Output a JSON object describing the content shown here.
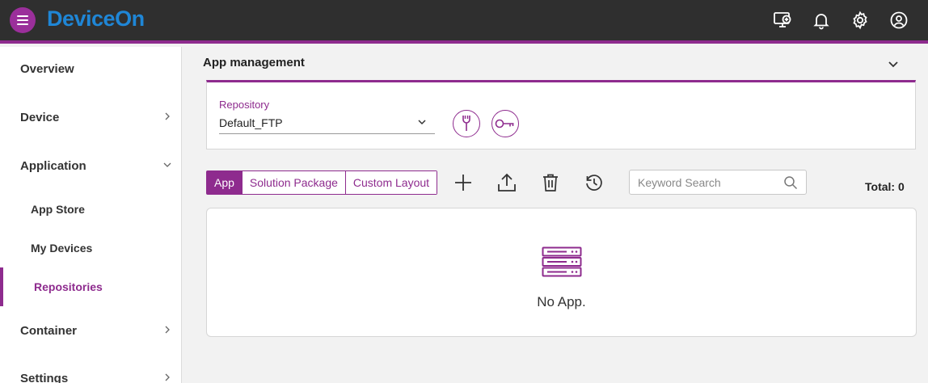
{
  "app": {
    "title": "DeviceOn"
  },
  "topbar": {
    "icons": [
      "monitor-add-icon",
      "bell-icon",
      "gear-icon",
      "user-circle-icon"
    ]
  },
  "sidebar": {
    "items": [
      {
        "label": "Overview"
      },
      {
        "label": "Device"
      },
      {
        "label": "Application"
      },
      {
        "label": "App Store"
      },
      {
        "label": "My Devices"
      },
      {
        "label": "Repositories"
      },
      {
        "label": "Container"
      },
      {
        "label": "Settings"
      }
    ],
    "active": "Repositories"
  },
  "main": {
    "section_title": "App management",
    "repository": {
      "label": "Repository",
      "value": "Default_FTP"
    },
    "tabs": [
      {
        "label": "App",
        "active": true
      },
      {
        "label": "Solution Package",
        "active": false
      },
      {
        "label": "Custom Layout",
        "active": false
      }
    ],
    "toolbar_icons": [
      "add-icon",
      "upload-icon",
      "trash-icon",
      "history-icon"
    ],
    "search": {
      "placeholder": "Keyword Search",
      "value": ""
    },
    "total": "Total: 0",
    "empty_text": "No App."
  },
  "colors": {
    "accent": "#8e2b8e",
    "topbar": "#2f2f2f",
    "logo": "#1f86d6"
  }
}
